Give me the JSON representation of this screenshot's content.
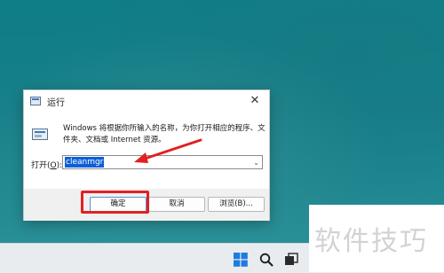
{
  "dialog": {
    "title": "运行",
    "close_glyph": "✕",
    "description": "Windows 将根据你所输入的名称，为你打开相应的程序、文件夹、文档或 Internet 资源。",
    "open_label_prefix": "打开(",
    "open_label_key": "O",
    "open_label_suffix": "):",
    "open_value": "cleanmgr",
    "dropdown_glyph": "⌄",
    "ok_label": "确定",
    "cancel_label": "取消",
    "browse_label": "浏览(B)..."
  },
  "annotation": {
    "highlight_color": "#e02121"
  },
  "watermark": {
    "text": "软件技巧"
  },
  "taskbar": {
    "icons": [
      "windows-start-icon",
      "search-icon",
      "task-view-icon"
    ]
  }
}
